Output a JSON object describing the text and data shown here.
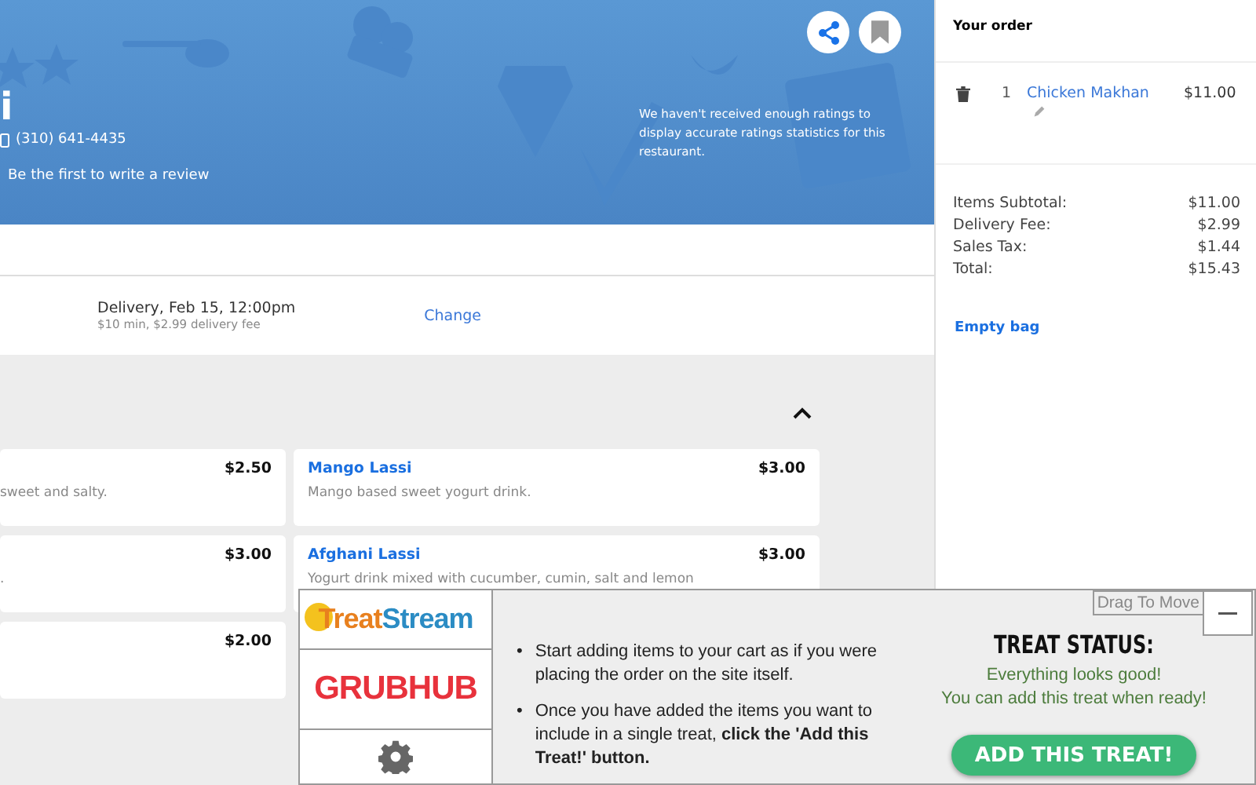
{
  "header": {
    "name_fragment": "i",
    "phone": "(310) 641-4435",
    "review_link": "Be the first to write a review",
    "ratings_note": "We haven't received enough ratings to display accurate ratings statistics for this restaurant."
  },
  "delivery": {
    "summary": "Delivery, Feb 15, 12:00pm",
    "details": "$10 min, $2.99 delivery fee",
    "change": "Change"
  },
  "menu": {
    "expanded": true,
    "items": [
      {
        "description": "sweet and salty.",
        "price": "$2.50"
      },
      {
        "name": "Mango Lassi",
        "description": "Mango based sweet yogurt drink.",
        "price": "$3.00"
      },
      {
        "description": ".",
        "price": "$3.00"
      },
      {
        "name": "Afghani Lassi",
        "description": "Yogurt drink mixed with cucumber, cumin, salt and lemon",
        "price": "$3.00"
      },
      {
        "price": "$2.00"
      }
    ]
  },
  "order": {
    "title": "Your order",
    "items": [
      {
        "quantity": "1",
        "name": "Chicken Makhan",
        "price": "$11.00"
      }
    ],
    "totals": [
      {
        "label": "Items Subtotal:",
        "value": "$11.00"
      },
      {
        "label": "Delivery Fee:",
        "value": "$2.99"
      },
      {
        "label": "Sales Tax:",
        "value": "$1.44"
      },
      {
        "label": "Total:",
        "value": "$15.43"
      }
    ],
    "empty_bag": "Empty bag"
  },
  "treat_panel": {
    "logo": [
      {
        "text": "Treat",
        "color": "#e8801e"
      },
      {
        "text": "Stream",
        "color": "#2b8cc4"
      }
    ],
    "grubhub": "GRUBHUB",
    "drag": "Drag To Move",
    "instructions": [
      {
        "bullet": "•",
        "text": "Start adding items to your cart as if you were placing the order on the site itself."
      },
      {
        "bullet": "•",
        "text": "Once you have added the items you want to include in a single treat, **click the 'Add this Treat!' button.**"
      }
    ],
    "status_title": "TREAT STATUS:",
    "status_lines": [
      "Everything looks good!",
      "You can add this treat when ready!"
    ],
    "button": "ADD THIS TREAT!"
  }
}
